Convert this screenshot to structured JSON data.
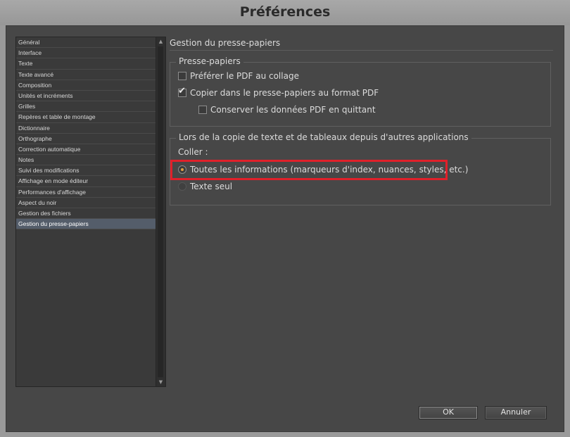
{
  "window": {
    "title": "Préférences"
  },
  "sidebar": {
    "items": [
      {
        "label": "Général",
        "selected": false
      },
      {
        "label": "Interface",
        "selected": false
      },
      {
        "label": "Texte",
        "selected": false
      },
      {
        "label": "Texte avancé",
        "selected": false
      },
      {
        "label": "Composition",
        "selected": false
      },
      {
        "label": "Unités et incréments",
        "selected": false
      },
      {
        "label": "Grilles",
        "selected": false
      },
      {
        "label": "Repères et table de montage",
        "selected": false
      },
      {
        "label": "Dictionnaire",
        "selected": false
      },
      {
        "label": "Orthographe",
        "selected": false
      },
      {
        "label": "Correction automatique",
        "selected": false
      },
      {
        "label": "Notes",
        "selected": false
      },
      {
        "label": "Suivi des modifications",
        "selected": false
      },
      {
        "label": "Affichage en mode éditeur",
        "selected": false
      },
      {
        "label": "Performances d'affichage",
        "selected": false
      },
      {
        "label": "Aspect du noir",
        "selected": false
      },
      {
        "label": "Gestion des fichiers",
        "selected": false
      },
      {
        "label": "Gestion du presse-papiers",
        "selected": true
      }
    ],
    "scroll_up_icon": "▲",
    "scroll_down_icon": "▼"
  },
  "panel": {
    "title": "Gestion du presse-papiers",
    "clipboard_group": {
      "legend": "Presse-papiers",
      "prefer_pdf": {
        "label": "Préférer le PDF au collage",
        "checked": false
      },
      "copy_pdf": {
        "label": "Copier dans le presse-papiers au format PDF",
        "checked": true
      },
      "keep_pdf": {
        "label": "Conserver les données PDF en quittant",
        "checked": false
      }
    },
    "paste_group": {
      "legend": "Lors de la copie de texte et de tableaux depuis d'autres applications",
      "paste_label": "Coller :",
      "all_info": {
        "label": "Toutes les informations (marqueurs d'index, nuances, styles, etc.)",
        "selected": true
      },
      "text_only": {
        "label": "Texte seul",
        "selected": false
      }
    }
  },
  "buttons": {
    "ok": "OK",
    "cancel": "Annuler"
  },
  "colors": {
    "highlight": "#e0202a",
    "dialog_bg": "#474747",
    "selected_item": "#545d6a"
  }
}
